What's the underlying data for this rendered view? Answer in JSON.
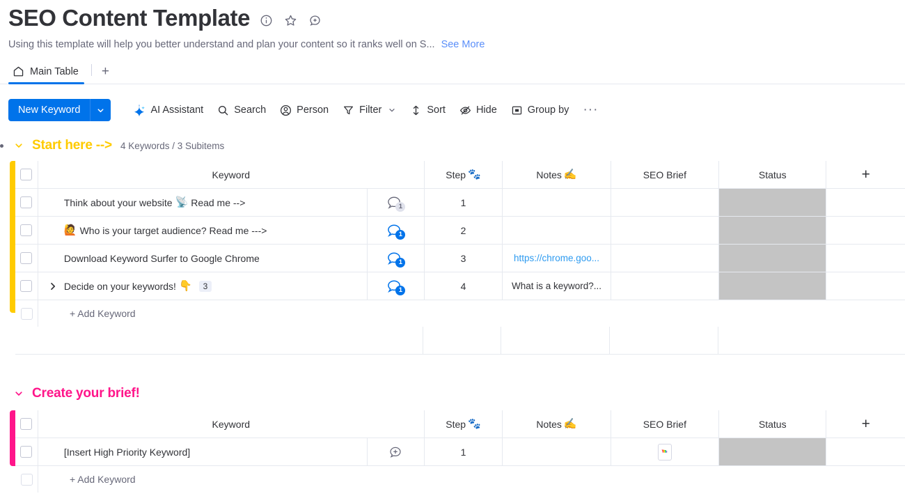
{
  "header": {
    "title": "SEO Content Template",
    "icons": [
      "info-icon",
      "star-icon",
      "add-comment-icon"
    ],
    "description": "Using this template will help you better understand and plan your content so it ranks well on S...",
    "see_more": "See More"
  },
  "tabs": {
    "items": [
      {
        "label": "Main Table",
        "icon": "home-icon",
        "active": true
      }
    ],
    "add_label": "+"
  },
  "toolbar": {
    "new_item": "New Keyword",
    "buttons": [
      {
        "label": "AI Assistant",
        "icon": "ai-icon"
      },
      {
        "label": "Search",
        "icon": "search-icon"
      },
      {
        "label": "Person",
        "icon": "person-icon"
      },
      {
        "label": "Filter",
        "icon": "filter-icon",
        "caret": true
      },
      {
        "label": "Sort",
        "icon": "sort-icon"
      },
      {
        "label": "Hide",
        "icon": "hide-icon"
      },
      {
        "label": "Group by",
        "icon": "groupby-icon"
      }
    ],
    "more": "···"
  },
  "groups": [
    {
      "name": "start-here",
      "title": "Start here -->",
      "color": "#ffcb00",
      "count": "4 Keywords / 3 Subitems",
      "columns": [
        "Keyword",
        "Step 🐾",
        "Notes ✍️",
        "SEO Brief",
        "Status",
        "+"
      ],
      "column_labels": {
        "keyword": "Keyword",
        "step": "Step",
        "step_emoji": "🐾",
        "notes": "Notes",
        "notes_emoji": "✍️",
        "brief": "SEO Brief",
        "status": "Status",
        "add": "+"
      },
      "rows": [
        {
          "keyword": "Think about your website 📡 Read me -->",
          "keyword_prefix": "",
          "keyword_text": "Think about your website",
          "keyword_emoji": "📡",
          "keyword_suffix": "Read me -->",
          "comments": "1",
          "comment_state": "read",
          "step": "1",
          "notes": "",
          "notes_type": "none",
          "brief": "",
          "status": "",
          "expandable": false,
          "subitems": ""
        },
        {
          "keyword": "🙋 Who is your target audience? Read me --->",
          "keyword_prefix": "🙋",
          "keyword_text": "Who is your target audience? Read me --->",
          "keyword_emoji": "",
          "keyword_suffix": "",
          "comments": "1",
          "comment_state": "unread",
          "step": "2",
          "notes": "",
          "notes_type": "none",
          "brief": "",
          "status": "",
          "expandable": false,
          "subitems": ""
        },
        {
          "keyword": "Download Keyword Surfer to Google Chrome",
          "keyword_prefix": "",
          "keyword_text": "Download Keyword Surfer to Google Chrome",
          "keyword_emoji": "",
          "keyword_suffix": "",
          "comments": "1",
          "comment_state": "unread",
          "step": "3",
          "notes": "https://chrome.goo...",
          "notes_type": "link",
          "brief": "",
          "status": "",
          "expandable": false,
          "subitems": ""
        },
        {
          "keyword": "Decide on your keywords! 👇 3",
          "keyword_prefix": "",
          "keyword_text": "Decide on your keywords!",
          "keyword_emoji": "👇",
          "keyword_suffix": "",
          "comments": "1",
          "comment_state": "unread",
          "step": "4",
          "notes": "What is a keyword?...",
          "notes_type": "text",
          "brief": "",
          "status": "",
          "expandable": true,
          "subitems": "3"
        }
      ],
      "add_row_label": "+ Add Keyword",
      "has_summary_row": true
    },
    {
      "name": "create-your-brief",
      "title": "Create your brief!",
      "color": "#ff158a",
      "count": "",
      "columns": [
        "Keyword",
        "Step 🐾",
        "Notes ✍️",
        "SEO Brief",
        "Status",
        "+"
      ],
      "column_labels": {
        "keyword": "Keyword",
        "step": "Step",
        "step_emoji": "🐾",
        "notes": "Notes",
        "notes_emoji": "✍️",
        "brief": "SEO Brief",
        "status": "Status",
        "add": "+"
      },
      "rows": [
        {
          "keyword": "[Insert High Priority Keyword]",
          "keyword_prefix": "",
          "keyword_text": "[Insert High Priority Keyword]",
          "keyword_emoji": "",
          "keyword_suffix": "",
          "comments": "",
          "comment_state": "empty",
          "step": "1",
          "notes": "",
          "notes_type": "none",
          "brief": "doc-file-icon",
          "status": "",
          "expandable": false,
          "subitems": ""
        }
      ],
      "add_row_label": "+ Add Keyword",
      "has_summary_row": false
    }
  ],
  "colors": {
    "accent_blue": "#0073ea",
    "group_yellow": "#ffcb00",
    "group_pink": "#ff158a",
    "status_empty": "#c4c4c4",
    "link_blue": "#2e9bf0"
  }
}
